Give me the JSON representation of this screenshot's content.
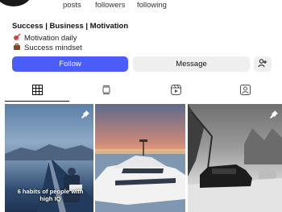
{
  "profile": {
    "stats": [
      {
        "label": "posts"
      },
      {
        "label": "followers"
      },
      {
        "label": "following"
      }
    ],
    "bio": {
      "name": "Success | Business | Motivation",
      "lines": [
        {
          "icon": "dart-icon",
          "text": "Motivation daily"
        },
        {
          "icon": "briefcase-icon",
          "text": "Success mindset"
        }
      ]
    }
  },
  "actions": {
    "follow_label": "Follow",
    "message_label": "Message"
  },
  "tabs": [
    "posts-grid",
    "feed",
    "reels",
    "tagged"
  ],
  "posts": [
    {
      "caption": "6 habits of people with high IQ",
      "pinned": true
    },
    {
      "caption": "",
      "pinned": false
    },
    {
      "caption": "",
      "pinned": true
    }
  ],
  "colors": {
    "accent": "#4a5df9",
    "secondary_button": "#efefef"
  }
}
